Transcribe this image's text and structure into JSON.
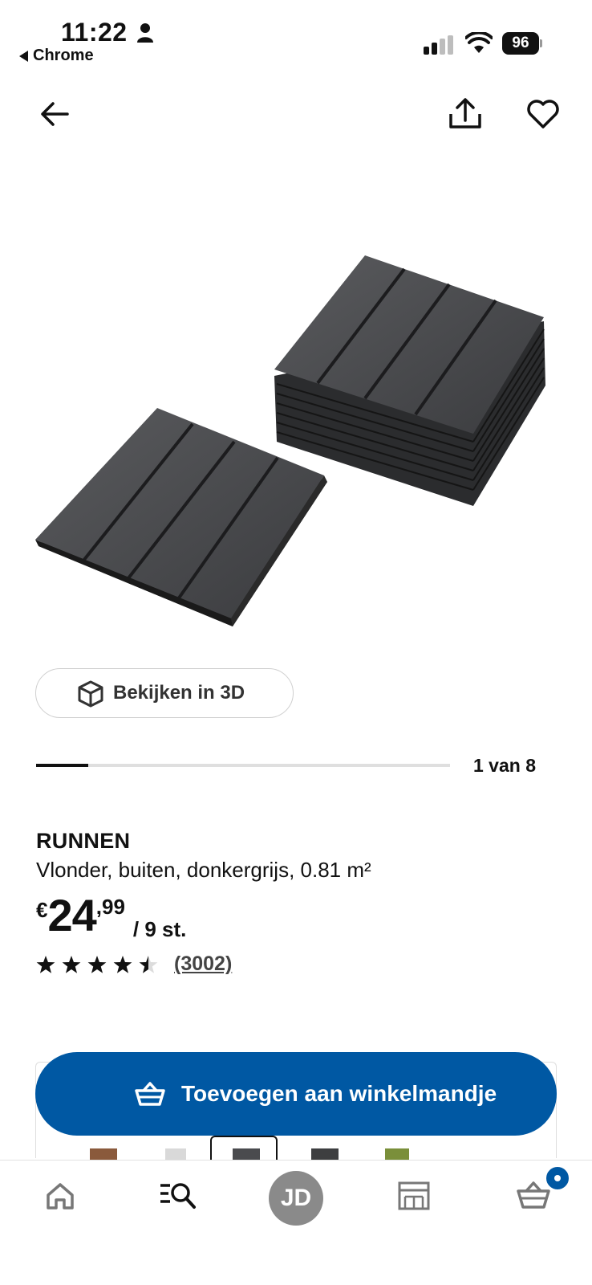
{
  "status_bar": {
    "time": "11:22",
    "back_app": "Chrome",
    "battery": "96",
    "icons": [
      "person-icon",
      "signal-icon",
      "wifi-icon",
      "battery-icon"
    ]
  },
  "top_nav": {
    "icons": [
      "arrow-left-icon",
      "share-icon",
      "heart-icon"
    ]
  },
  "gallery": {
    "view_3d_label": "Bekijken in 3D",
    "position_label": "1 van 8",
    "current": 1,
    "total": 8
  },
  "product": {
    "name": "RUNNEN",
    "description": "Vlonder, buiten, donkergrijs, 0.81 m²",
    "price": {
      "currency": "€",
      "integer": "24",
      "decimal": ",99",
      "unit": "/ 9 st."
    },
    "rating": {
      "stars": 4.5,
      "max": 5,
      "count_label": "(3002)"
    }
  },
  "actions": {
    "add_to_cart_label": "Toevoegen aan winkelmandje",
    "accent_color": "#0058a3"
  },
  "tab_bar": {
    "avatar_initials": "JD",
    "items": [
      "home-icon",
      "search-icon",
      "profile-avatar",
      "rooms-icon",
      "basket-icon"
    ]
  }
}
